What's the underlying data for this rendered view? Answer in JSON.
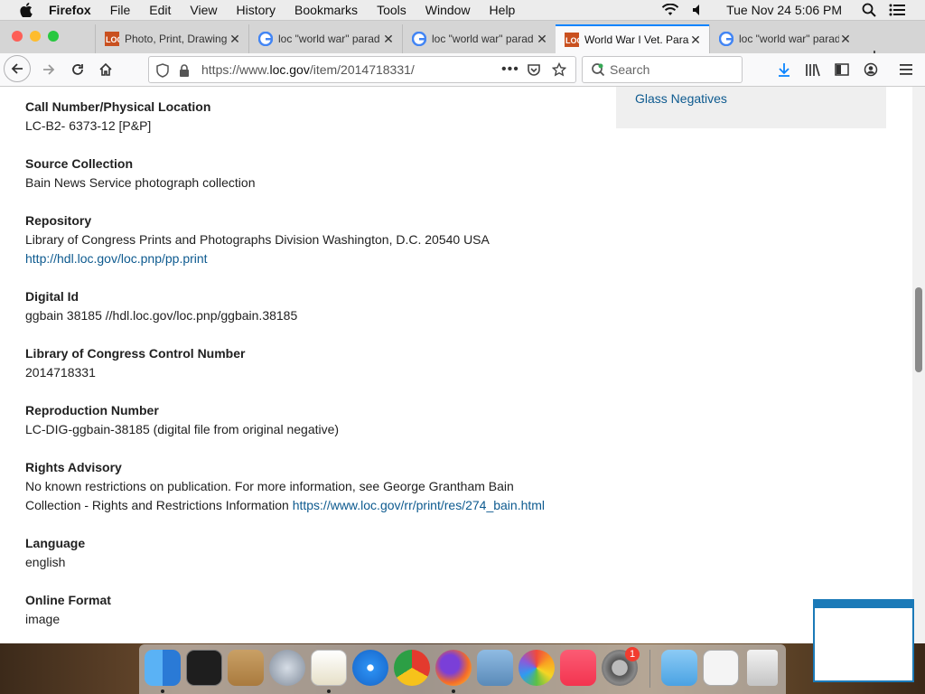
{
  "menubar": {
    "app_name": "Firefox",
    "menus": [
      "File",
      "Edit",
      "View",
      "History",
      "Bookmarks",
      "Tools",
      "Window",
      "Help"
    ],
    "clock": "Tue Nov 24  5:06 PM"
  },
  "tabs": [
    {
      "title": "Photo, Print, Drawing",
      "favicon": "loc-icon",
      "active": false
    },
    {
      "title": "loc \"world war\" parad",
      "favicon": "google-icon",
      "active": false
    },
    {
      "title": "loc \"world war\" parad",
      "favicon": "google-icon",
      "active": false
    },
    {
      "title": "World War I Vet. Para",
      "favicon": "loc-icon",
      "active": true
    },
    {
      "title": "loc \"world war\" parad",
      "favicon": "google-icon",
      "active": false
    }
  ],
  "toolbar": {
    "url_prefix": "https://www.",
    "url_host": "loc.gov",
    "url_path": "/item/2014718331/",
    "search_placeholder": "Search"
  },
  "sidebar": {
    "link": "Glass Negatives"
  },
  "record": {
    "call_number": {
      "label": "Call Number/Physical Location",
      "value": "LC-B2- 6373-12 [P&P]"
    },
    "source_collection": {
      "label": "Source Collection",
      "value": "Bain News Service photograph collection"
    },
    "repository": {
      "label": "Repository",
      "value": "Library of Congress Prints and Photographs Division Washington, D.C. 20540 USA",
      "link": "http://hdl.loc.gov/loc.pnp/pp.print"
    },
    "digital_id": {
      "label": "Digital Id",
      "value": "ggbain 38185 //hdl.loc.gov/loc.pnp/ggbain.38185"
    },
    "lccn": {
      "label": "Library of Congress Control Number",
      "value": "2014718331"
    },
    "reproduction_number": {
      "label": "Reproduction Number",
      "value": "LC-DIG-ggbain-38185 (digital file from original negative)"
    },
    "rights_advisory": {
      "label": "Rights Advisory",
      "value_line1": "No known restrictions on publication. For more information, see George Grantham Bain",
      "value_line2": "Collection - Rights and Restrictions Information",
      "link": "https://www.loc.gov/rr/print/res/274_bain.html"
    },
    "language": {
      "label": "Language",
      "value": "english"
    },
    "online_format": {
      "label": "Online Format",
      "value": "image"
    }
  },
  "dock": {
    "apps": [
      "Finder",
      "Terminal",
      "Calculator",
      "Launchpad",
      "TextEdit",
      "Safari",
      "Chrome",
      "Firefox",
      "Preview",
      "Photos",
      "Music",
      "System Preferences",
      "Downloads",
      "Screenshot",
      "Trash"
    ],
    "badge": "1"
  },
  "colors": {
    "link": "#0d5a8f",
    "accent": "#0a84ff"
  }
}
